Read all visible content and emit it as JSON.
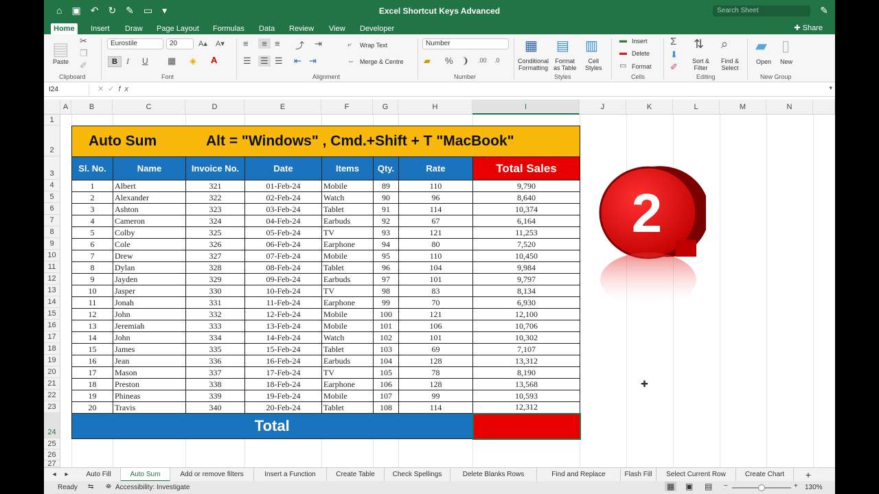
{
  "window": {
    "title": "Excel Shortcut Keys Advanced",
    "search_placeholder": "Search Sheet"
  },
  "ribbon_tabs": [
    "Home",
    "Insert",
    "Draw",
    "Page Layout",
    "Formulas",
    "Data",
    "Review",
    "View",
    "Developer"
  ],
  "share_label": "Share",
  "ribbon": {
    "clipboard": {
      "paste": "Paste",
      "label": "Clipboard"
    },
    "font": {
      "name": "Eurostile",
      "size": "20",
      "bold": "B",
      "italic": "I",
      "underline": "U",
      "label": "Font"
    },
    "alignment": {
      "wrap": "Wrap Text",
      "merge": "Merge & Centre",
      "label": "Alignment"
    },
    "number": {
      "format": "Number",
      "label": "Number"
    },
    "styles": {
      "conditional": "Conditional\nFormatting",
      "format_table": "Format\nas Table",
      "cell_styles": "Cell\nStyles",
      "label": "Styles"
    },
    "cells": {
      "insert": "Insert",
      "delete": "Delete",
      "format": "Format",
      "label": "Cells"
    },
    "editing": {
      "sort": "Sort &\nFilter",
      "find": "Find &\nSelect",
      "label": "Editing"
    },
    "newgroup": {
      "open": "Open",
      "new": "New",
      "label": "New Group"
    }
  },
  "formula_bar": {
    "cell_ref": "I24",
    "formula": ""
  },
  "columns": [
    "A",
    "B",
    "C",
    "D",
    "E",
    "F",
    "G",
    "H",
    "I",
    "J",
    "K",
    "L",
    "M",
    "N"
  ],
  "rows": [
    "1",
    "2",
    "3",
    "4",
    "5",
    "6",
    "7",
    "8",
    "9",
    "10",
    "11",
    "12",
    "13",
    "14",
    "15",
    "16",
    "17",
    "18",
    "19",
    "20",
    "21",
    "22",
    "23",
    "24",
    "25",
    "26",
    "27"
  ],
  "table": {
    "title_left": "Auto Sum",
    "title_right": "Alt = \"Windows\" , Cmd.+Shift + T  \"MacBook\"",
    "headers": [
      "Sl. No.",
      "Name",
      "Invoice No.",
      "Date",
      "Items",
      "Qty.",
      "Rate",
      "Total Sales"
    ],
    "rows": [
      [
        "1",
        "Albert",
        "321",
        "01-Feb-24",
        "Mobile",
        "89",
        "110",
        "9,790"
      ],
      [
        "2",
        "Alexander",
        "322",
        "02-Feb-24",
        "Watch",
        "90",
        "96",
        "8,640"
      ],
      [
        "3",
        "Ashton",
        "323",
        "03-Feb-24",
        "Tablet",
        "91",
        "114",
        "10,374"
      ],
      [
        "4",
        "Cameron",
        "324",
        "04-Feb-24",
        "Earbuds",
        "92",
        "67",
        "6,164"
      ],
      [
        "5",
        "Colby",
        "325",
        "05-Feb-24",
        "TV",
        "93",
        "121",
        "11,253"
      ],
      [
        "6",
        "Cole",
        "326",
        "06-Feb-24",
        "Earphone",
        "94",
        "80",
        "7,520"
      ],
      [
        "7",
        "Drew",
        "327",
        "07-Feb-24",
        "Mobile",
        "95",
        "110",
        "10,450"
      ],
      [
        "8",
        "Dylan",
        "328",
        "08-Feb-24",
        "Tablet",
        "96",
        "104",
        "9,984"
      ],
      [
        "9",
        "Jayden",
        "329",
        "09-Feb-24",
        "Earbuds",
        "97",
        "101",
        "9,797"
      ],
      [
        "10",
        "Jasper",
        "330",
        "10-Feb-24",
        "TV",
        "98",
        "83",
        "8,134"
      ],
      [
        "11",
        "Jonah",
        "331",
        "11-Feb-24",
        "Earphone",
        "99",
        "70",
        "6,930"
      ],
      [
        "12",
        "John",
        "332",
        "12-Feb-24",
        "Mobile",
        "100",
        "121",
        "12,100"
      ],
      [
        "13",
        "Jeremiah",
        "333",
        "13-Feb-24",
        "Mobile",
        "101",
        "106",
        "10,706"
      ],
      [
        "14",
        "John",
        "334",
        "14-Feb-24",
        "Watch",
        "102",
        "101",
        "10,302"
      ],
      [
        "15",
        "James",
        "335",
        "15-Feb-24",
        "Tablet",
        "103",
        "69",
        "7,107"
      ],
      [
        "16",
        "Jean",
        "336",
        "16-Feb-24",
        "Earbuds",
        "104",
        "128",
        "13,312"
      ],
      [
        "17",
        "Mason",
        "337",
        "17-Feb-24",
        "TV",
        "105",
        "78",
        "8,190"
      ],
      [
        "18",
        "Preston",
        "338",
        "18-Feb-24",
        "Earphone",
        "106",
        "128",
        "13,568"
      ],
      [
        "19",
        "Phineas",
        "339",
        "19-Feb-24",
        "Mobile",
        "107",
        "99",
        "10,593"
      ],
      [
        "20",
        "Travis",
        "340",
        "20-Feb-24",
        "Tablet",
        "108",
        "114",
        "12,312"
      ]
    ],
    "total_label": "Total"
  },
  "badge_number": "2",
  "sheet_tabs": [
    "Auto Fill",
    "Auto Sum",
    "Add or remove filters",
    "Insert a Function",
    "Create Table",
    "Check Spellings",
    "Delete Blanks Rows",
    "Find and Replace",
    "Flash Fill",
    "Select Current Row",
    "Create Chart"
  ],
  "active_sheet": "Auto Sum",
  "status": {
    "ready": "Ready",
    "accessibility": "Accessibility: Investigate",
    "zoom": "130%"
  },
  "colors": {
    "excel_green": "#227447",
    "header_blue": "#1a74bd",
    "title_orange": "#f8b80c",
    "total_red": "#e60000"
  }
}
